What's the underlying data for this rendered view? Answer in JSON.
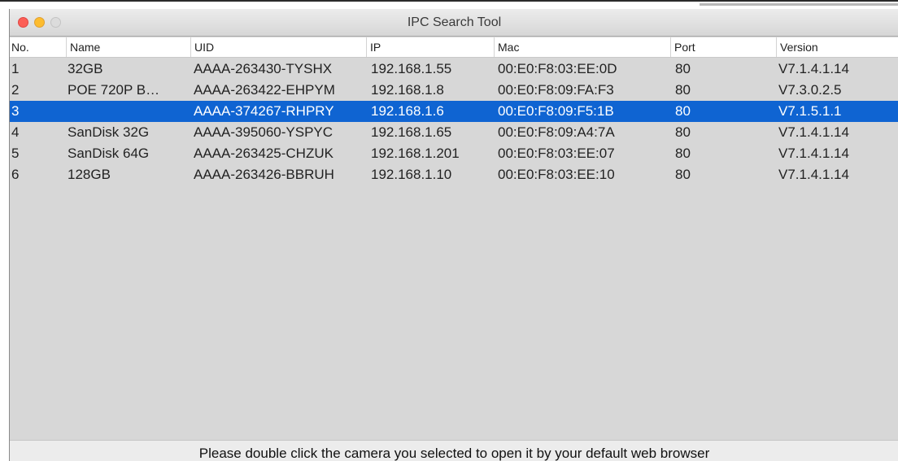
{
  "window": {
    "title": "IPC Search Tool"
  },
  "table": {
    "columns": [
      "No.",
      "Name",
      "UID",
      "IP",
      "Mac",
      "Port",
      "Version"
    ],
    "selected_row": 3,
    "rows": [
      [
        "1",
        "32GB",
        "AAAA-263430-TYSHX",
        "192.168.1.55",
        "00:E0:F8:03:EE:0D",
        "80",
        "V7.1.4.1.14"
      ],
      [
        "2",
        "POE 720P B…",
        "AAAA-263422-EHPYM",
        "192.168.1.8",
        "00:E0:F8:09:FA:F3",
        "80",
        "V7.3.0.2.5"
      ],
      [
        "3",
        "",
        "AAAA-374267-RHPRY",
        "192.168.1.6",
        "00:E0:F8:09:F5:1B",
        "80",
        "V7.1.5.1.1"
      ],
      [
        "4",
        "SanDisk 32G",
        "AAAA-395060-YSPYC",
        "192.168.1.65",
        "00:E0:F8:09:A4:7A",
        "80",
        "V7.1.4.1.14"
      ],
      [
        "5",
        "SanDisk 64G",
        "AAAA-263425-CHZUK",
        "192.168.1.201",
        "00:E0:F8:03:EE:07",
        "80",
        "V7.1.4.1.14"
      ],
      [
        "6",
        "128GB",
        "AAAA-263426-BBRUH",
        "192.168.1.10",
        "00:E0:F8:03:EE:10",
        "80",
        "V7.1.4.1.14"
      ]
    ]
  },
  "footer": {
    "hint": "Please double click the camera you selected to open it by your default web browser"
  },
  "colors": {
    "selection": "#0f64d2",
    "close": "#fc5f57",
    "minimize": "#fdbc2e",
    "zoom_disabled": "#dcdcdc"
  }
}
